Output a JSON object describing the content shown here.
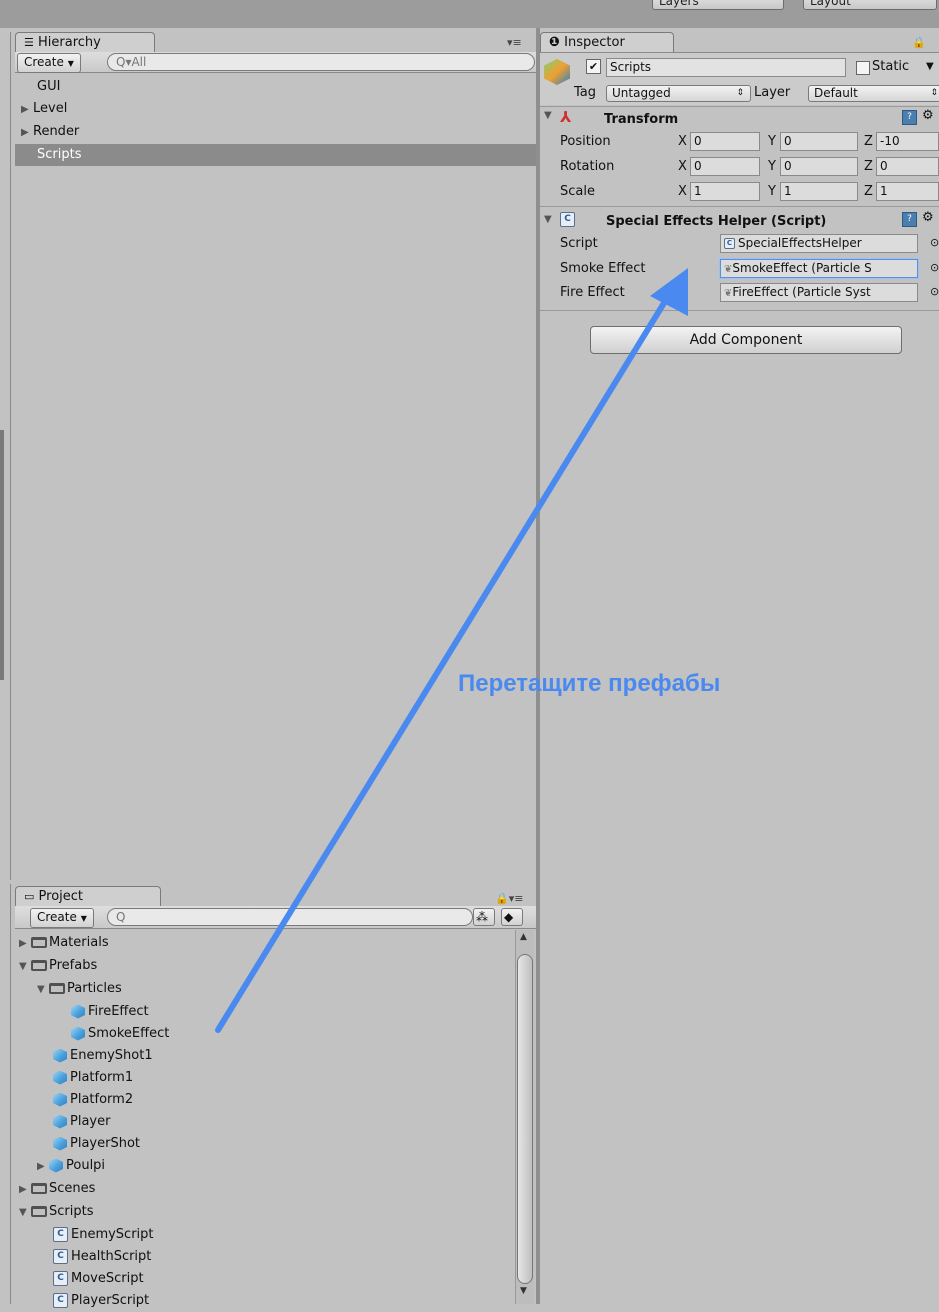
{
  "topbar": {
    "layers_label": "Layers",
    "layout_label": "Layout"
  },
  "hierarchy": {
    "tab_label": "Hierarchy",
    "create_label": "Create",
    "search_placeholder": "All",
    "items": [
      "GUI",
      "Level",
      "Render",
      "Scripts"
    ],
    "selected": "Scripts"
  },
  "project": {
    "tab_label": "Project",
    "create_label": "Create",
    "tree": {
      "materials": "Materials",
      "prefabs": "Prefabs",
      "particles": "Particles",
      "fire_effect": "FireEffect",
      "smoke_effect": "SmokeEffect",
      "enemy_shot": "EnemyShot1",
      "platform1": "Platform1",
      "platform2": "Platform2",
      "player": "Player",
      "player_shot": "PlayerShot",
      "poulpi": "Poulpi",
      "scenes": "Scenes",
      "scripts": "Scripts",
      "enemy_script": "EnemyScript",
      "health_script": "HealthScript",
      "move_script": "MoveScript",
      "player_script": "PlayerScript"
    }
  },
  "inspector": {
    "tab_label": "Inspector",
    "object_name": "Scripts",
    "static_label": "Static",
    "tag_label": "Tag",
    "tag_value": "Untagged",
    "layer_label": "Layer",
    "layer_value": "Default",
    "transform": {
      "title": "Transform",
      "position_label": "Position",
      "rotation_label": "Rotation",
      "scale_label": "Scale",
      "x": "X",
      "y": "Y",
      "z": "Z",
      "position": [
        "0",
        "0",
        "-10"
      ],
      "rotation": [
        "0",
        "0",
        "0"
      ],
      "scale": [
        "1",
        "1",
        "1"
      ]
    },
    "script_component": {
      "title": "Special Effects Helper (Script)",
      "script_label": "Script",
      "script_value": "SpecialEffectsHelper",
      "smoke_label": "Smoke Effect",
      "smoke_value": "SmokeEffect (Particle S",
      "fire_label": "Fire Effect",
      "fire_value": "FireEffect (Particle Syst"
    },
    "add_component_label": "Add Component"
  },
  "annotation": {
    "text": "Перетащите префабы",
    "color": "#4a8af0"
  },
  "colors": {
    "panel_bg": "#c2c2c2",
    "selection": "#8b8b8b",
    "arrow": "#4a8af0"
  }
}
